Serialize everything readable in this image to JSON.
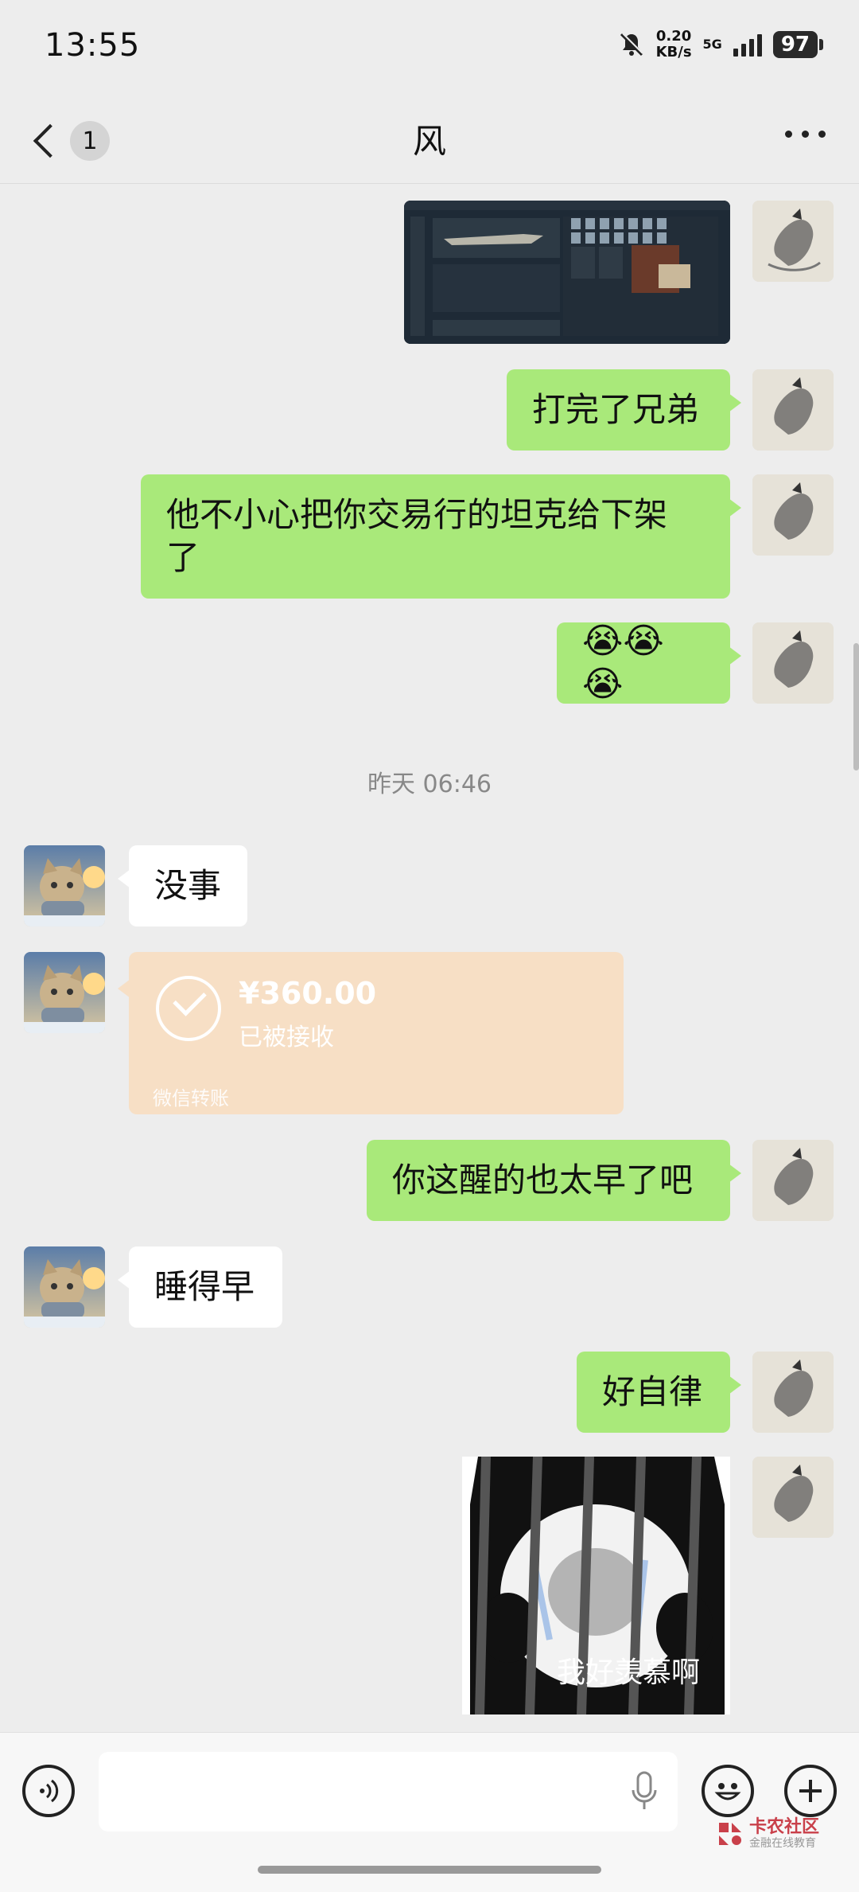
{
  "status_bar": {
    "time": "13:55",
    "net_speed": "0.20",
    "net_unit": "KB/s",
    "network": "5G",
    "battery": "97"
  },
  "header": {
    "unread_count": "1",
    "title": "风"
  },
  "messages": {
    "m2": "打完了兄弟",
    "m3_line1": "他不小心把你交易行的坦克给下架",
    "m3_line2": "了",
    "m4": "😭😭😭",
    "time_sep": "昨天 06:46",
    "m5": "没事",
    "transfer_amount": "¥360.00",
    "transfer_status": "已被接收",
    "transfer_source": "微信转账",
    "m7": "你这醒的也太早了吧",
    "m8": "睡得早",
    "m9": "好自律",
    "sticker_caption": "我好羡慕啊"
  },
  "watermark": {
    "title": "卡农社区",
    "subtitle": "金融在线教育"
  },
  "colors": {
    "chat_bg": "#ededed",
    "bubble_out": "#a9e97a",
    "bubble_in": "#ffffff",
    "transfer_bg": "#f7dfc5"
  },
  "icons": [
    "back-chevron-icon",
    "more-dots-icon",
    "voice-icon",
    "mic-icon",
    "emoji-icon",
    "plus-icon"
  ]
}
